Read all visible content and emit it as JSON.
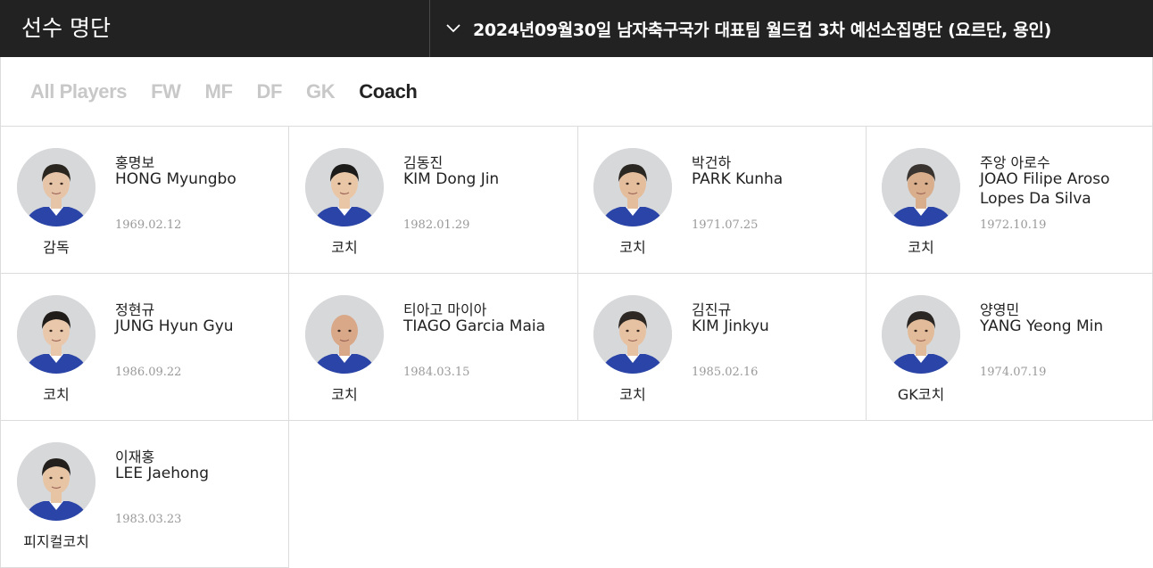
{
  "header": {
    "title": "선수 명단",
    "roster_select": "2024년09월30일 남자축구국가 대표팀 월드컵 3차 예선소집명단 (요르단, 용인)"
  },
  "tabs": [
    {
      "label": "All Players",
      "active": false
    },
    {
      "label": "FW",
      "active": false
    },
    {
      "label": "MF",
      "active": false
    },
    {
      "label": "DF",
      "active": false
    },
    {
      "label": "GK",
      "active": false
    },
    {
      "label": "Coach",
      "active": true
    }
  ],
  "staff": [
    {
      "korean_name": "홍명보",
      "english_name": "HONG Myungbo",
      "birth": "1969.02.12",
      "role": "감독",
      "photo": "avatar-icon"
    },
    {
      "korean_name": "김동진",
      "english_name": "KIM Dong Jin",
      "birth": "1982.01.29",
      "role": "코치",
      "photo": "avatar-icon"
    },
    {
      "korean_name": "박건하",
      "english_name": "PARK Kunha",
      "birth": "1971.07.25",
      "role": "코치",
      "photo": "avatar-icon"
    },
    {
      "korean_name": "주앙 아로수",
      "english_name": "JOAO Filipe Aroso Lopes Da Silva",
      "birth": "1972.10.19",
      "role": "코치",
      "photo": "avatar-icon"
    },
    {
      "korean_name": "정현규",
      "english_name": "JUNG Hyun Gyu",
      "birth": "1986.09.22",
      "role": "코치",
      "photo": "avatar-icon"
    },
    {
      "korean_name": "티아고 마이아",
      "english_name": "TIAGO Garcia Maia",
      "birth": "1984.03.15",
      "role": "코치",
      "photo": "avatar-icon"
    },
    {
      "korean_name": "김진규",
      "english_name": "KIM Jinkyu",
      "birth": "1985.02.16",
      "role": "코치",
      "photo": "avatar-icon"
    },
    {
      "korean_name": "양영민",
      "english_name": "YANG Yeong Min",
      "birth": "1974.07.19",
      "role": "GK코치",
      "photo": "avatar-icon"
    },
    {
      "korean_name": "이재홍",
      "english_name": "LEE Jaehong",
      "birth": "1983.03.23",
      "role": "피지컬코치",
      "photo": "avatar-icon"
    }
  ],
  "colors": {
    "header_bg": "#222222",
    "tab_active": "#222222",
    "tab_inactive": "#c8c8c8",
    "jersey": "#2a44a8",
    "border": "#dcdcdc"
  }
}
